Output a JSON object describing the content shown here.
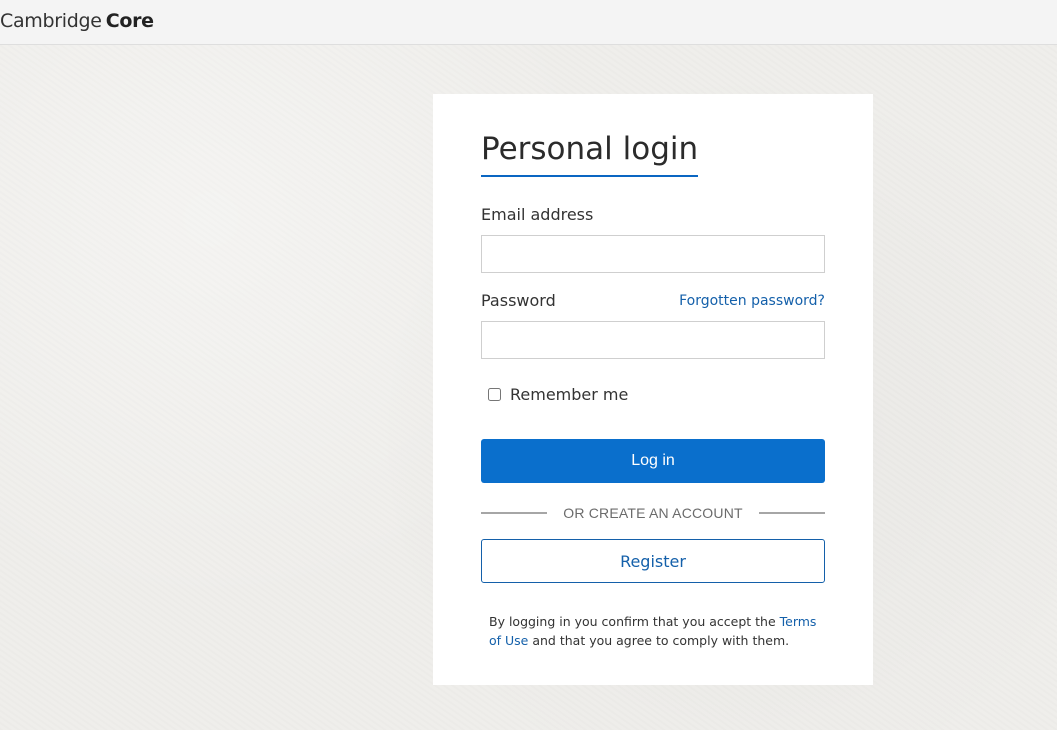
{
  "header": {
    "logo_light": "Cambridge",
    "logo_bold": "Core"
  },
  "login": {
    "title": "Personal login",
    "email_label": "Email address",
    "email_value": "",
    "password_label": "Password",
    "password_value": "",
    "forgot_link": "Forgotten password?",
    "remember_label": "Remember me",
    "remember_checked": false,
    "login_button": "Log in",
    "divider_text": "OR CREATE AN ACCOUNT",
    "register_button": "Register",
    "terms_prefix": "By logging in you confirm that you accept the ",
    "terms_link": "Terms of Use",
    "terms_suffix": " and that you agree to comply with them."
  },
  "colors": {
    "primary": "#0a6fcc",
    "link": "#1460aa",
    "background": "#efeeeb"
  }
}
